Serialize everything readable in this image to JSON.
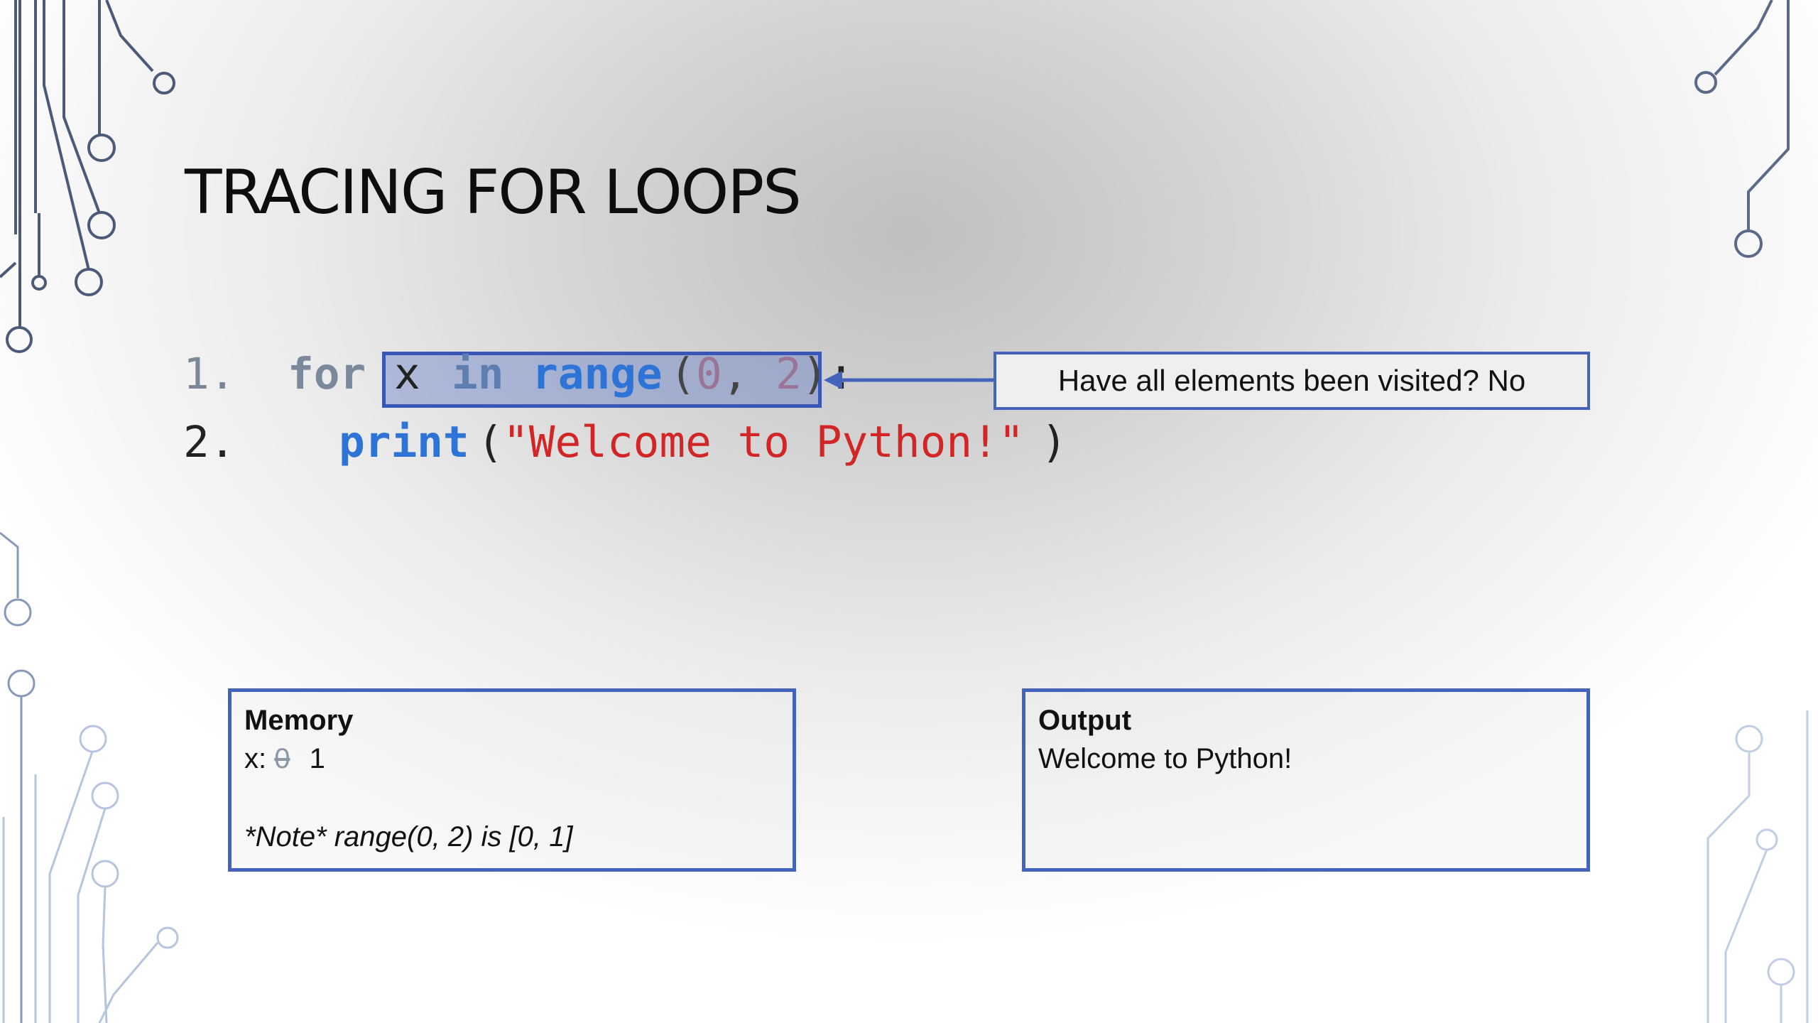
{
  "slide": {
    "title": "TRACING FOR LOOPS"
  },
  "code": {
    "line1": {
      "number": "1.",
      "keyword": "for",
      "variable": "x",
      "in_keyword": "in",
      "function": "range",
      "open_paren": "(",
      "arg1": "0",
      "comma": ",",
      "arg2": "2",
      "close_paren": ")",
      "colon": ":"
    },
    "line2": {
      "number": "2.",
      "function": "print",
      "open_paren": "(",
      "string": "\"Welcome to Python!\"",
      "close_paren": ")"
    }
  },
  "callout": {
    "text": "Have all elements been visited? No"
  },
  "memory": {
    "title": "Memory",
    "variable_label": "x:",
    "old_value": "0",
    "current_value": "1",
    "note": "*Note* range(0, 2) is [0, 1]"
  },
  "output": {
    "title": "Output",
    "text": "Welcome to Python!"
  },
  "colors": {
    "accent_border": "#4463bd",
    "keyword_blue": "#2d74d6",
    "string_red": "#d22525",
    "highlight_fill": "#607ac8"
  },
  "icons": {
    "callout_arrow": "arrow-left-icon"
  }
}
